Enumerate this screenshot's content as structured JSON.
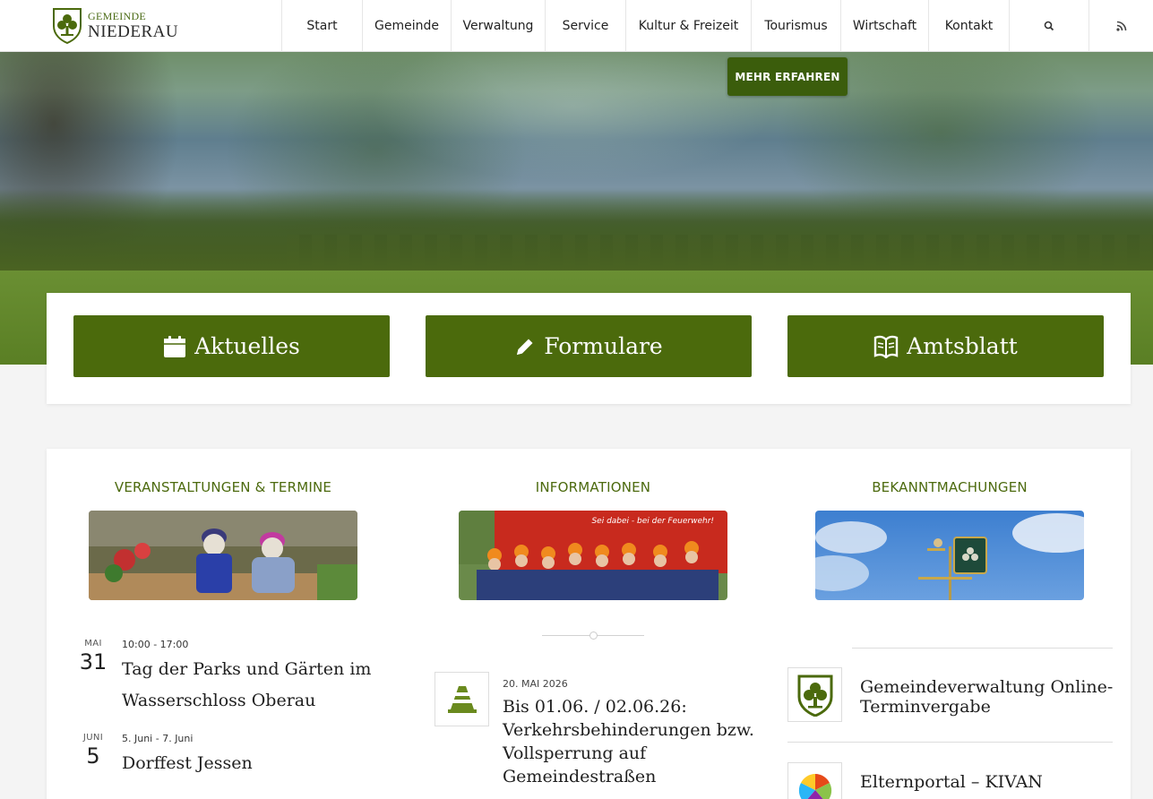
{
  "header": {
    "logo": {
      "line1": "GEMEINDE",
      "line2": "NIEDERAU"
    },
    "nav": [
      {
        "label": "Start"
      },
      {
        "label": "Gemeinde"
      },
      {
        "label": "Verwaltung"
      },
      {
        "label": "Service"
      },
      {
        "label": "Kultur & Freizeit"
      },
      {
        "label": "Tourismus"
      },
      {
        "label": "Wirtschaft"
      },
      {
        "label": "Kontakt"
      }
    ],
    "icons": [
      "search-icon",
      "rss-icon"
    ]
  },
  "hero": {
    "button_label": "MEHR ERFAHREN"
  },
  "quick_links": [
    {
      "label": "Aktuelles",
      "icon": "calendar-icon"
    },
    {
      "label": "Formulare",
      "icon": "pencil-icon"
    },
    {
      "label": "Amtsblatt",
      "icon": "open-book-icon"
    }
  ],
  "columns": {
    "events": {
      "title": "VERANSTALTUNGEN & TERMINE",
      "items": [
        {
          "month": "MAI",
          "day": "31",
          "time": "10:00 - 17:00",
          "title": "Tag der Parks und Gärten im Wasserschloss Oberau"
        },
        {
          "month": "JUNI",
          "day": "5",
          "time": "5. Juni - 7. Juni",
          "title": "Dorffest Jessen"
        }
      ]
    },
    "info": {
      "title": "INFORMATIONEN",
      "image_caption": "Sei dabei - bei der Feuerwehr!",
      "items": [
        {
          "date": "20. MAI 2026",
          "title": "Bis 01.06. / 02.06.26: Verkehrsbehinderungen bzw. Vollsperrung auf Gemeindestraßen",
          "icon": "traffic-cone-icon"
        }
      ]
    },
    "announcements": {
      "title": "BEKANNTMACHUNGEN",
      "items": [
        {
          "title": "Gemeindeverwaltung Online-Terminvergabe",
          "icon": "municipal-crest-icon"
        },
        {
          "title": "Elternportal – KIVAN",
          "icon": "kivan-logo-icon"
        }
      ]
    }
  },
  "colors": {
    "primary_green": "#4b6a0c",
    "title_green": "#4c6a0e"
  }
}
